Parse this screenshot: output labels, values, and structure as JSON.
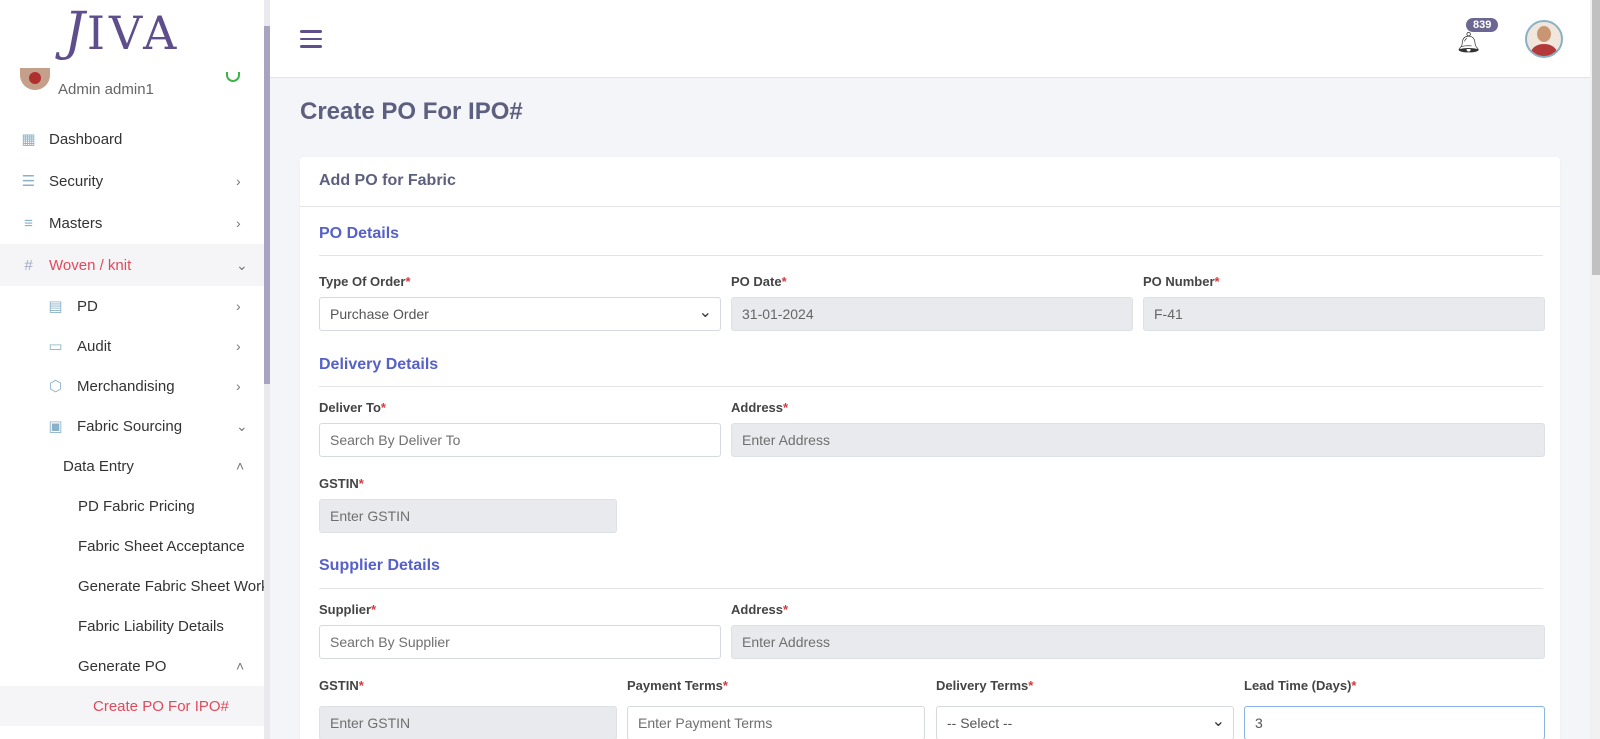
{
  "brand": {
    "logo_j": "J",
    "logo_rest": "IVA"
  },
  "user": {
    "name": "Admin admin1"
  },
  "sidebar": {
    "items": [
      {
        "label": "Dashboard",
        "icon": "dashboard-icon",
        "chevron": ""
      },
      {
        "label": "Security",
        "icon": "sliders-icon",
        "chevron": "›"
      },
      {
        "label": "Masters",
        "icon": "masters-icon",
        "chevron": "›"
      },
      {
        "label": "Woven / knit",
        "icon": "grid-icon",
        "chevron": "⌄"
      }
    ],
    "sub": [
      {
        "label": "PD",
        "chevron": "›"
      },
      {
        "label": "Audit",
        "chevron": "›"
      },
      {
        "label": "Merchandising",
        "chevron": "›"
      },
      {
        "label": "Fabric Sourcing",
        "chevron": "⌄"
      }
    ],
    "data_entry": {
      "label": "Data Entry",
      "chevron": "˄"
    },
    "data_entry_items": [
      {
        "label": "PD Fabric Pricing"
      },
      {
        "label": "Fabric Sheet Acceptance"
      },
      {
        "label": "Generate Fabric Sheet Working"
      },
      {
        "label": "Fabric Liability Details"
      }
    ],
    "generate_po": {
      "label": "Generate PO",
      "chevron": "˄"
    },
    "create_po": {
      "label": "Create PO For IPO#"
    }
  },
  "header": {
    "notification_count": "839"
  },
  "page": {
    "title": "Create PO For IPO#"
  },
  "card": {
    "title": "Add PO for Fabric"
  },
  "po_details": {
    "title": "PO Details",
    "type_label": "Type Of Order",
    "type_value": "Purchase Order",
    "date_label": "PO Date",
    "date_value": "31-01-2024",
    "number_label": "PO Number",
    "number_value": "F-41"
  },
  "delivery": {
    "title": "Delivery Details",
    "deliver_to_label": "Deliver To",
    "deliver_to_placeholder": "Search By Deliver To",
    "address_label": "Address",
    "address_placeholder": "Enter Address",
    "gstin_label": "GSTIN",
    "gstin_placeholder": "Enter GSTIN"
  },
  "supplier": {
    "title": "Supplier Details",
    "supplier_label": "Supplier",
    "supplier_placeholder": "Search By Supplier",
    "address_label": "Address",
    "address_placeholder": "Enter Address",
    "gstin_label": "GSTIN",
    "gstin_placeholder": "Enter GSTIN",
    "payment_label": "Payment Terms",
    "payment_placeholder": "Enter Payment Terms",
    "delivery_terms_label": "Delivery Terms",
    "delivery_terms_value": "-- Select --",
    "lead_time_label": "Lead Time (Days)",
    "lead_time_value": "3"
  },
  "required_mark": "*"
}
